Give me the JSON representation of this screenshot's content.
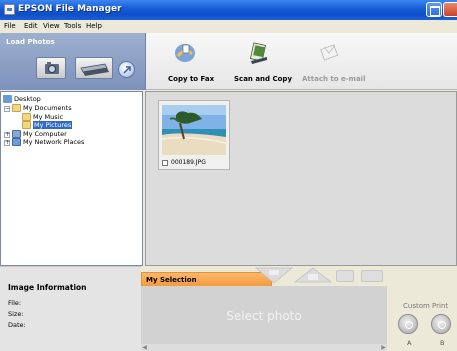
{
  "window": {
    "title": "EPSON File Manager"
  },
  "menu": [
    "File",
    "Edit",
    "View",
    "Tools",
    "Help"
  ],
  "toolbar": {
    "load_title": "Load Photos",
    "copy_to_fax": "Copy to Fax",
    "scan_and_copy": "Scan and Copy",
    "attach_to_email": "Attach to e-mail"
  },
  "tree": {
    "desktop": "Desktop",
    "my_documents": "My Documents",
    "my_music": "My Music",
    "my_pictures": "My Pictures",
    "my_computer": "My Computer",
    "my_network_places": "My Network Places"
  },
  "thumbnail": {
    "file_name": "000189.JPG"
  },
  "image_info": {
    "title": "Image Information",
    "file_label": "File:",
    "size_label": "Size:",
    "date_label": "Date:"
  },
  "selection": {
    "tab_label": "My Selection",
    "placeholder": "Select photo"
  },
  "custom_print": {
    "label": "Custom Print",
    "button_a": "A",
    "button_b": "B"
  }
}
